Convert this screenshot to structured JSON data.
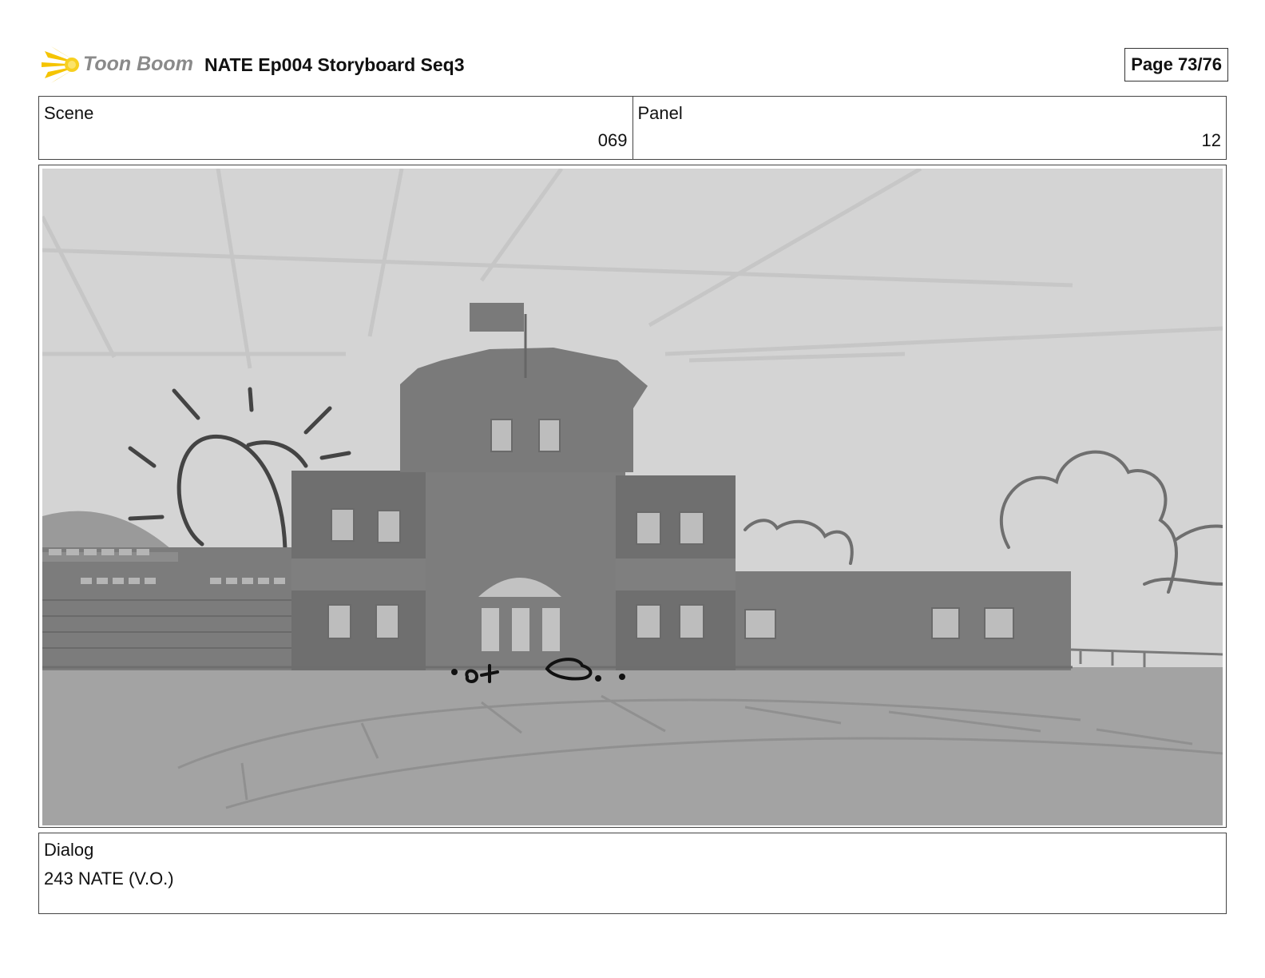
{
  "header": {
    "logo_text": "Toon Boom",
    "logo_icon": "starburst-icon",
    "title": "NATE Ep004 Storyboard Seq3",
    "page": "Page 73/76"
  },
  "scene": {
    "label": "Scene",
    "value": "069"
  },
  "panel": {
    "label": "Panel",
    "value": "12"
  },
  "dialog": {
    "label": "Dialog",
    "text": "243 NATE (V.O.)"
  },
  "colors": {
    "sky": "#d4d4d4",
    "ground": "#a3a3a3",
    "building": "#7f7f7f",
    "logo_yellow": "#f5c400"
  }
}
